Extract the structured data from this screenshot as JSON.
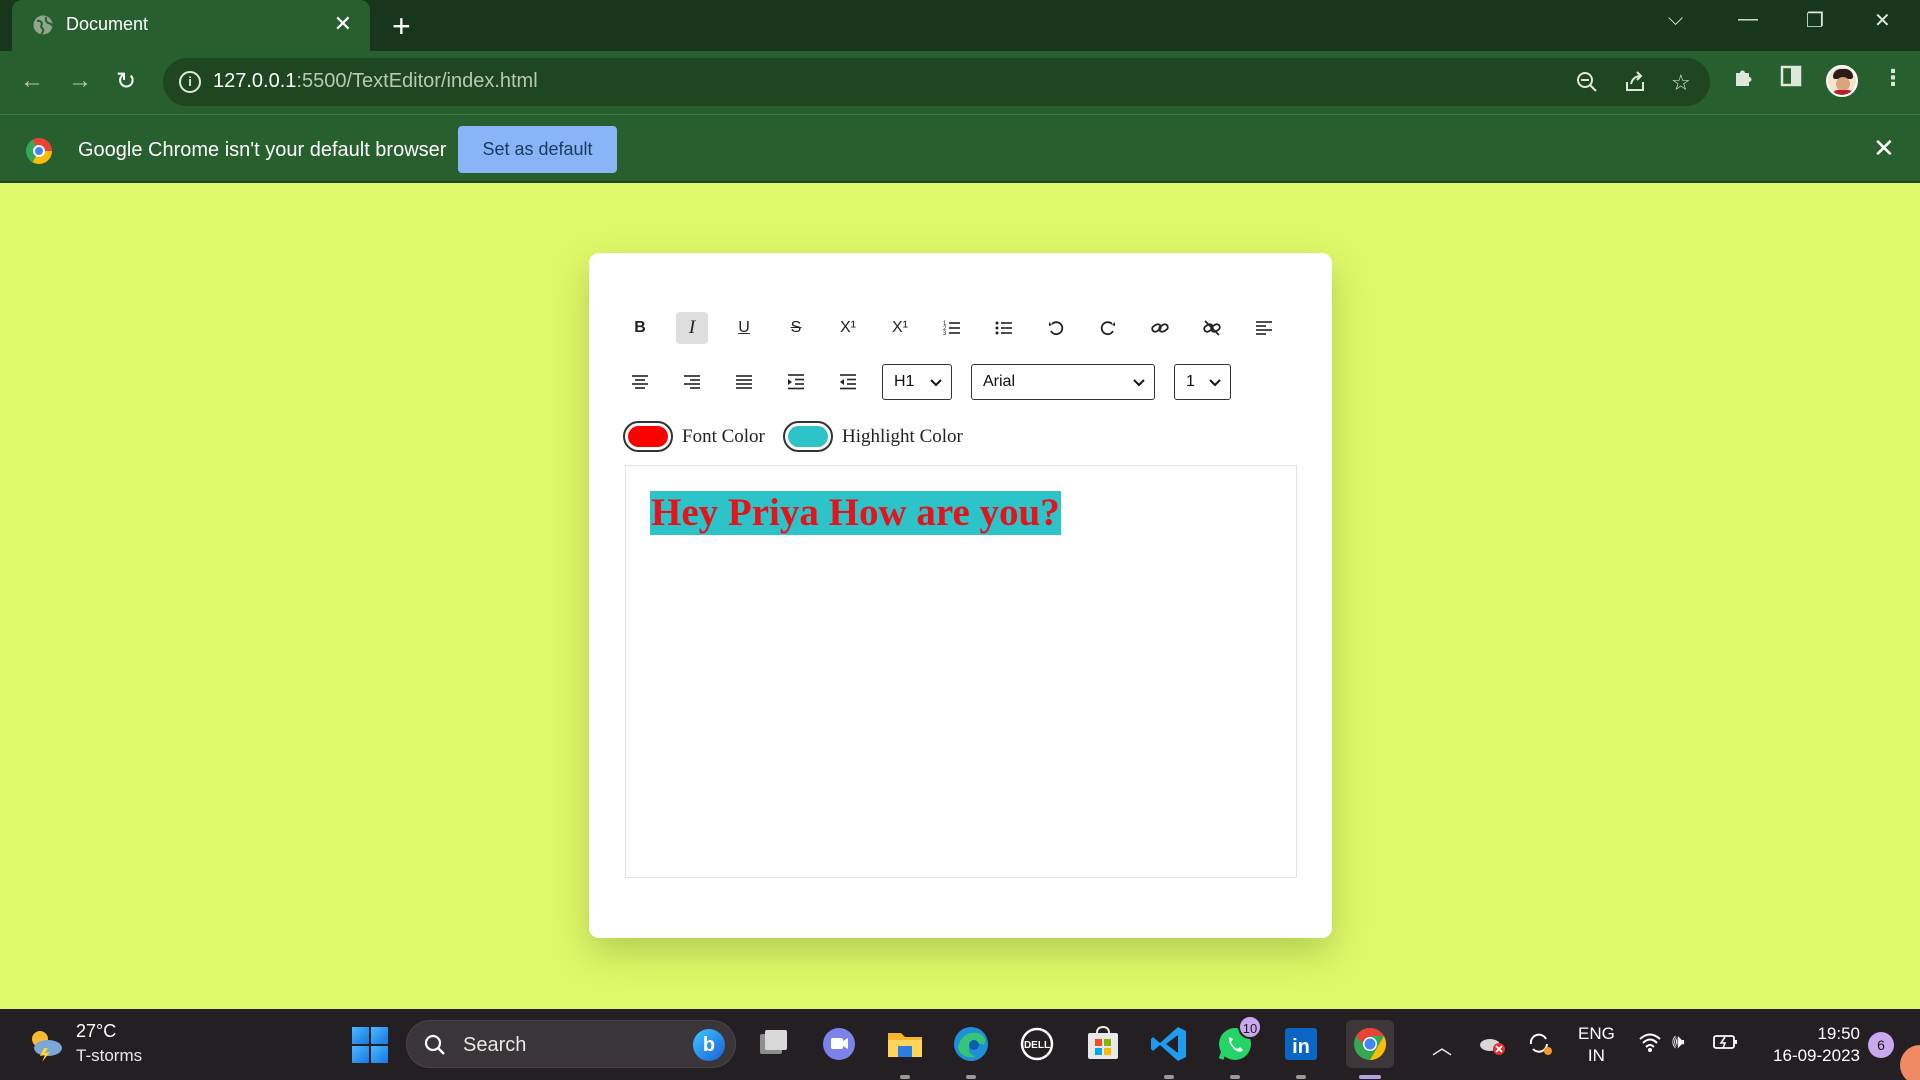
{
  "browser": {
    "tab_title": "Document",
    "url_host": "127.0.0.1",
    "url_path": ":5500/TextEditor/index.html",
    "infobar_message": "Google Chrome isn't your default browser",
    "set_default_label": "Set as default"
  },
  "editor": {
    "toolbar_row1": [
      {
        "name": "bold-button",
        "icon": "bold-icon",
        "label": "B"
      },
      {
        "name": "italic-button",
        "icon": "italic-icon",
        "label": "I",
        "active": true
      },
      {
        "name": "underline-button",
        "icon": "underline-icon",
        "label": "U"
      },
      {
        "name": "strikethrough-button",
        "icon": "strikethrough-icon",
        "label": "S"
      },
      {
        "name": "superscript-button",
        "icon": "superscript-icon",
        "label": "X¹"
      },
      {
        "name": "subscript-button",
        "icon": "subscript-icon",
        "label": "X¹"
      },
      {
        "name": "ordered-list-button",
        "icon": "ordered-list-icon"
      },
      {
        "name": "unordered-list-button",
        "icon": "unordered-list-icon"
      },
      {
        "name": "undo-button",
        "icon": "undo-icon"
      },
      {
        "name": "redo-button",
        "icon": "redo-icon"
      },
      {
        "name": "link-button",
        "icon": "link-icon"
      },
      {
        "name": "unlink-button",
        "icon": "unlink-icon"
      },
      {
        "name": "align-left-button",
        "icon": "align-left-icon"
      }
    ],
    "toolbar_row2": [
      {
        "name": "align-center-button",
        "icon": "align-center-icon"
      },
      {
        "name": "align-right-button",
        "icon": "align-right-icon"
      },
      {
        "name": "justify-button",
        "icon": "justify-icon"
      },
      {
        "name": "indent-button",
        "icon": "indent-icon"
      },
      {
        "name": "outdent-button",
        "icon": "outdent-icon"
      }
    ],
    "heading_select": "H1",
    "font_select": "Arial",
    "size_select": "1",
    "font_color_label": "Font Color",
    "font_color": "#ff0000",
    "highlight_color_label": "Highlight Color",
    "highlight_color": "#2cc4c8",
    "content_text": "Hey Priya How are you?"
  },
  "taskbar": {
    "weather_temp": "27°C",
    "weather_desc": "T-storms",
    "search_label": "Search",
    "whatsapp_badge": "10",
    "lang_line1": "ENG",
    "lang_line2": "IN",
    "time": "19:50",
    "date": "16-09-2023",
    "notification_count": "6"
  },
  "colors": {
    "page_background": "#dff96a",
    "chrome_frame": "#285f2e",
    "set_default_button": "#8ab4f8"
  }
}
